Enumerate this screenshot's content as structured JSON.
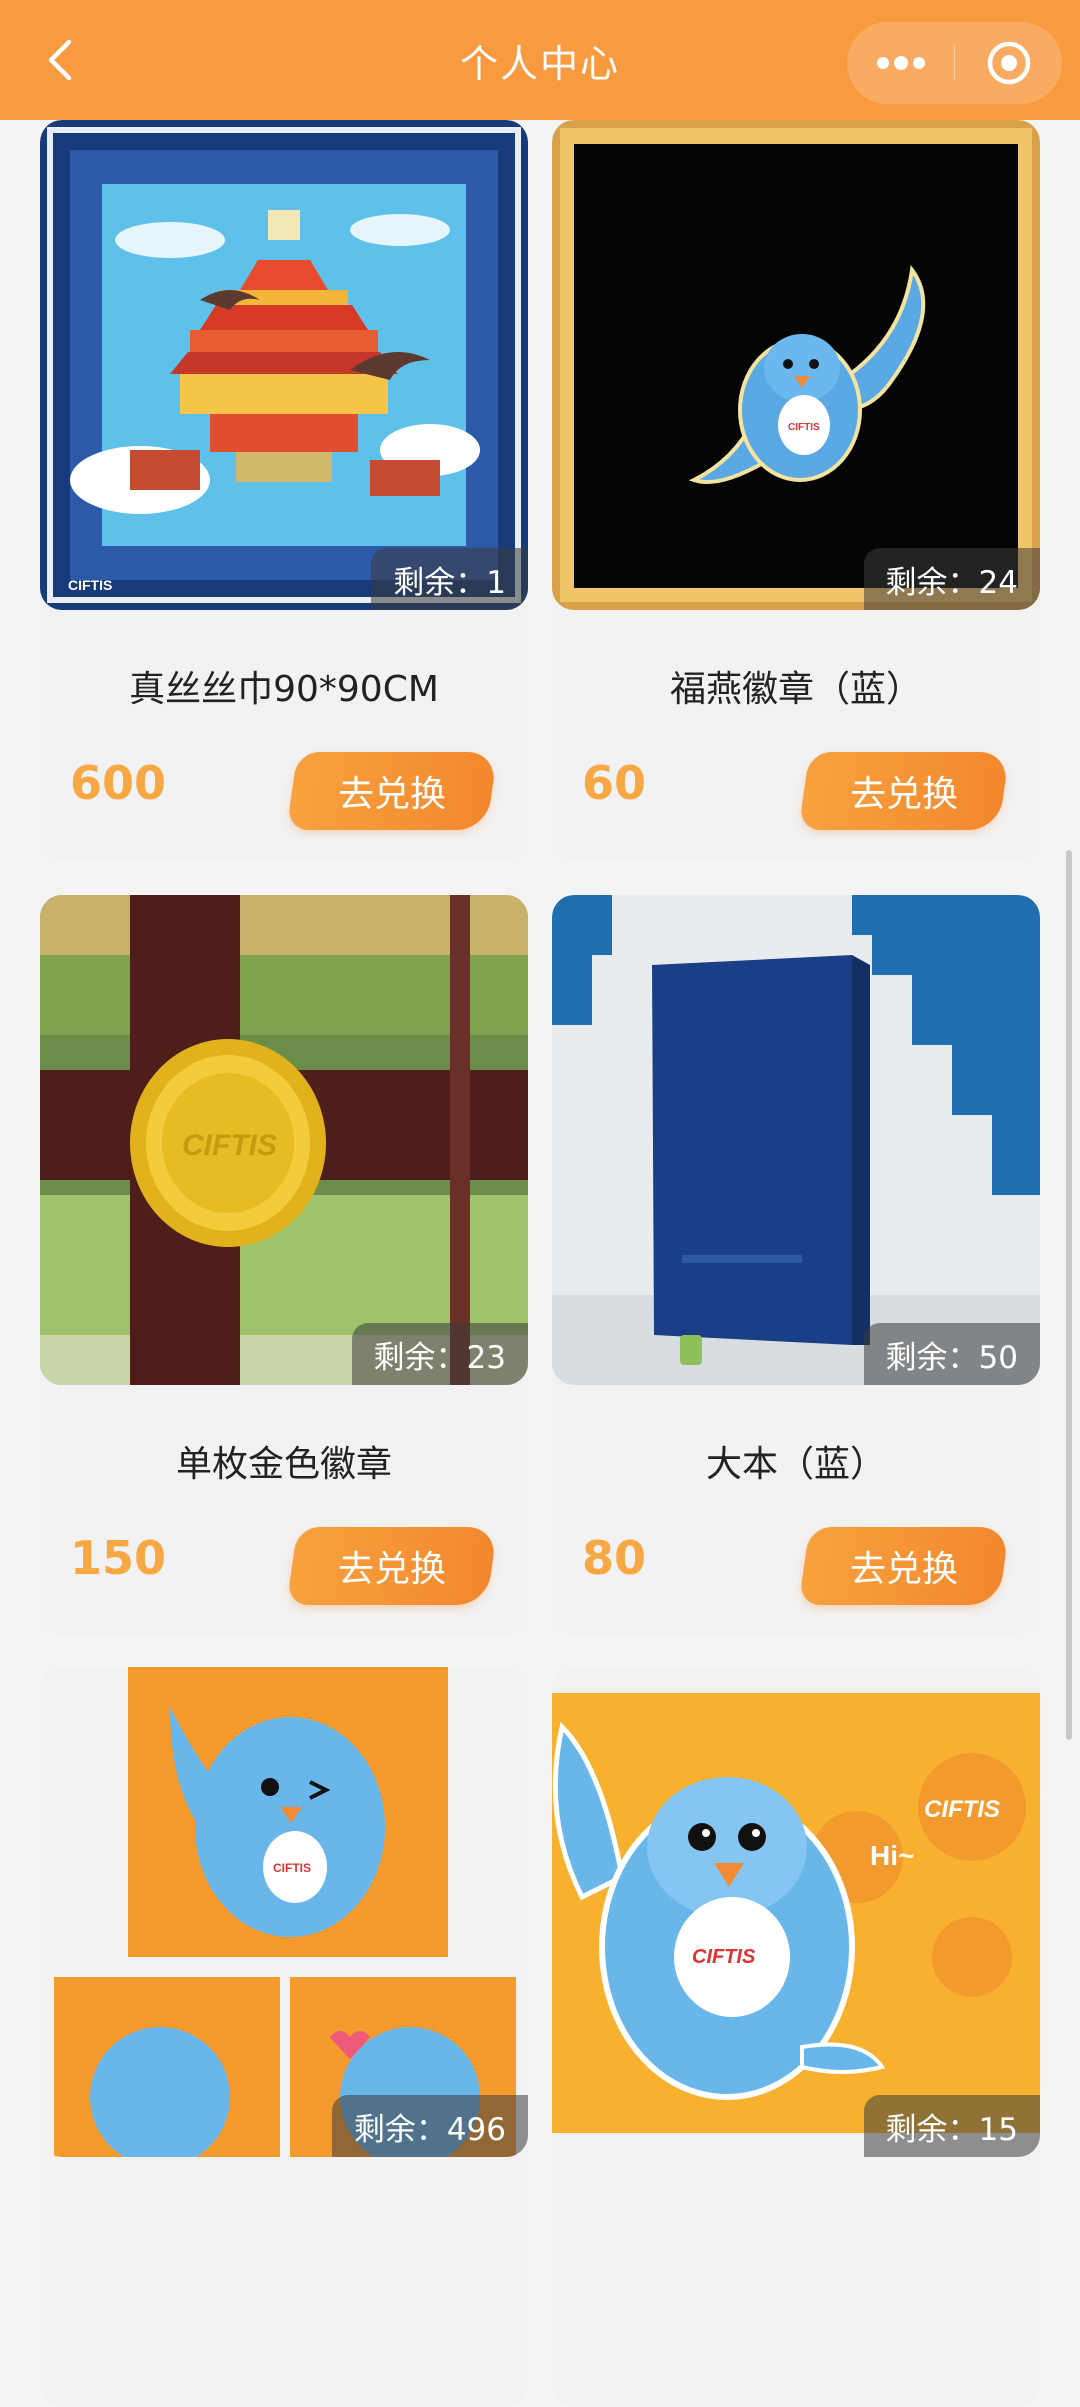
{
  "navbar": {
    "title": "个人中心"
  },
  "products": [
    {
      "name": "真丝丝巾90*90CM",
      "price": "600",
      "stock": "剩余：1",
      "button": "去兑换"
    },
    {
      "name": "福燕徽章（蓝）",
      "price": "60",
      "stock": "剩余：24",
      "button": "去兑换"
    },
    {
      "name": "单枚金色徽章",
      "price": "150",
      "stock": "剩余：23",
      "button": "去兑换"
    },
    {
      "name": "大本（蓝）",
      "price": "80",
      "stock": "剩余：50",
      "button": "去兑换"
    },
    {
      "name": "",
      "price": "",
      "stock": "剩余：496",
      "button": ""
    },
    {
      "name": "",
      "price": "",
      "stock": "剩余：15",
      "button": ""
    }
  ],
  "images": {
    "scarf_brand": "CIFTIS",
    "badge_brand": "CIFTIS",
    "sticker_brand": "CIFTIS",
    "sticker_greeting": "Hi~"
  },
  "colors": {
    "navbar": "#f89a3f",
    "price": "#f7a845",
    "button_start": "#f7a23e",
    "button_end": "#f3872e"
  }
}
